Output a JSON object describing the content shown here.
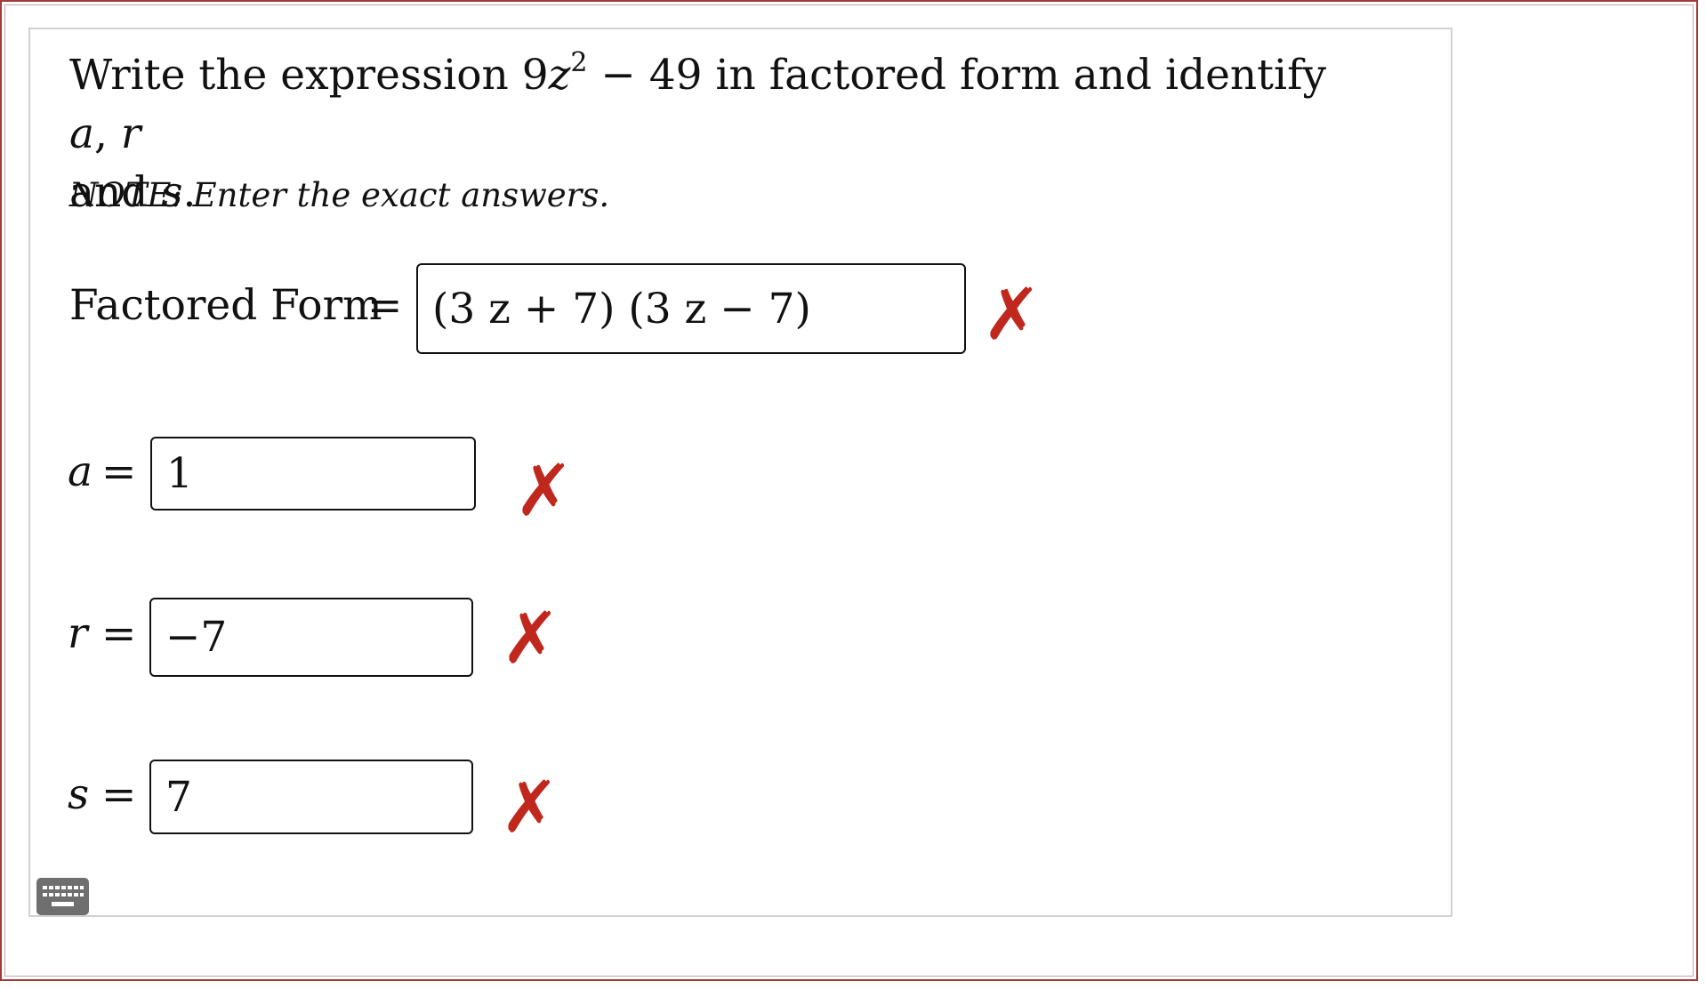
{
  "prompt": {
    "part1": "Write the expression ",
    "coef": "9",
    "var_z": "z",
    "exponent": "2",
    "part2": " − 49 in factored form and identify ",
    "var_a": "a",
    "comma": ", ",
    "var_r": "r",
    "part3": "and ",
    "var_s": "s",
    "period": "."
  },
  "note": "NOTE: Enter the exact answers.",
  "fields": {
    "factored": {
      "label": "Factored Form",
      "eq": "=",
      "value": "(3 z + 7) (3 z − 7)",
      "mark": "✗"
    },
    "a": {
      "label": "a",
      "eq": "=",
      "value": "1",
      "mark": "✗"
    },
    "r": {
      "label": "r",
      "eq": "=",
      "value": "−7",
      "mark": "✗"
    },
    "s": {
      "label": "s",
      "eq": "=",
      "value": "7",
      "mark": "✗"
    }
  },
  "colors": {
    "incorrect": "#c0281e",
    "frame": "#a33a3a"
  },
  "icons": {
    "keyboard": "keyboard-icon",
    "incorrect": "x-mark-icon"
  }
}
